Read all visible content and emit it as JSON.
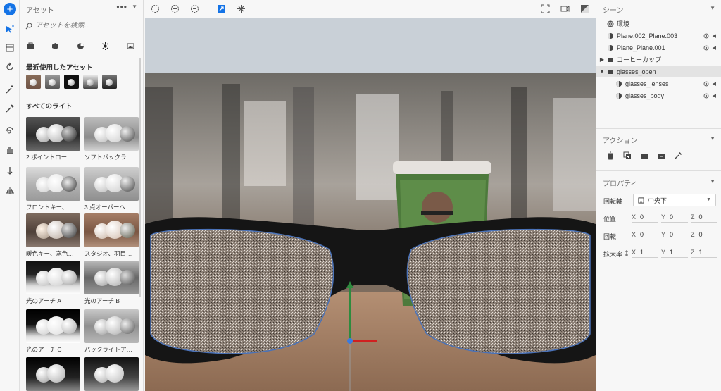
{
  "assets_panel": {
    "title": "アセット",
    "more": "•••",
    "search_placeholder": "アセットを検索...",
    "recent_title": "最近使用したアセット",
    "all_lights_title": "すべてのライト",
    "lights": [
      {
        "label": "2 ポイントロー…"
      },
      {
        "label": "ソフトバックラ…"
      },
      {
        "label": "フロントキー、…"
      },
      {
        "label": "3 点オーバーヘ…"
      },
      {
        "label": "暖色キー、寒色…"
      },
      {
        "label": "スタジオ、羽目…"
      },
      {
        "label": "光のアーチ A"
      },
      {
        "label": "光のアーチ B"
      },
      {
        "label": "光のアーチ C"
      },
      {
        "label": "バックライトア…"
      }
    ]
  },
  "scene_panel": {
    "title": "シーン",
    "items": [
      {
        "label": "環境",
        "icon": "globe-icon"
      },
      {
        "label": "Plane.002_Plane.003",
        "icon": "material-icon"
      },
      {
        "label": "Plane_Plane.001",
        "icon": "material-icon"
      },
      {
        "label": "コーヒーカップ",
        "icon": "folder-icon"
      },
      {
        "label": "glasses_open",
        "icon": "folder-icon"
      },
      {
        "label": "glasses_lenses",
        "icon": "material-icon"
      },
      {
        "label": "glasses_body",
        "icon": "material-icon"
      }
    ]
  },
  "actions_panel": {
    "title": "アクション"
  },
  "properties_panel": {
    "title": "プロパティ",
    "pivot_label": "回転軸",
    "pivot_value": "中央下",
    "position_label": "位置",
    "rotation_label": "回転",
    "scale_label": "拡大率",
    "position": {
      "x": "0",
      "y": "0",
      "z": "0"
    },
    "rotation": {
      "x": "0",
      "y": "0",
      "z": "0"
    },
    "scale": {
      "x": "1",
      "y": "1",
      "z": "1"
    },
    "axis_x": "X",
    "axis_y": "Y",
    "axis_z": "Z"
  },
  "colors": {
    "accent": "#1473e6",
    "selection": "#e3e3e3",
    "panel_bg": "#f7f7f7"
  }
}
